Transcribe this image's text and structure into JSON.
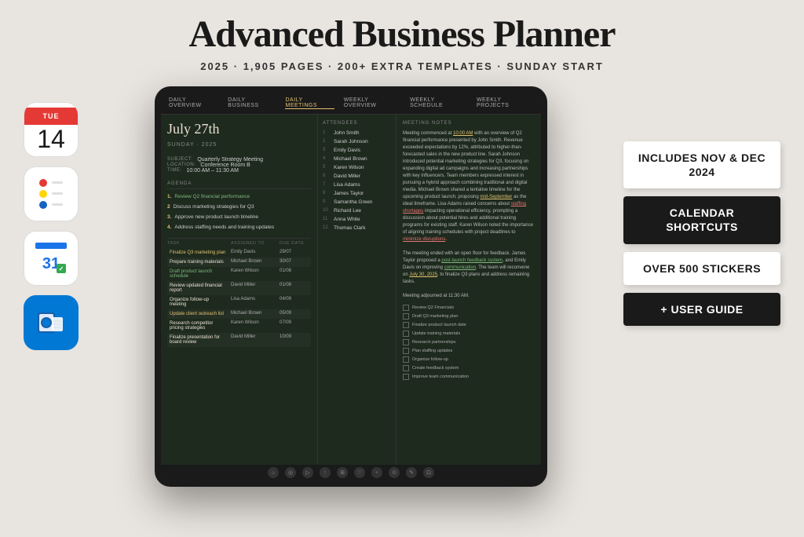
{
  "header": {
    "title": "Advanced Business Planner",
    "subtitle": "2025  ·  1,905 PAGES  ·  200+ EXTRA TEMPLATES  ·  SUNDAY START"
  },
  "left_icons": [
    {
      "id": "calendar",
      "day": "TUE",
      "date": "14"
    },
    {
      "id": "reminders"
    },
    {
      "id": "gcal",
      "number": "31"
    },
    {
      "id": "outlook"
    }
  ],
  "tablet": {
    "nav_items": [
      "DAILY OVERVIEW",
      "DAILY BUSINESS",
      "DAILY MEETINGS",
      "WEEKLY OVERVIEW",
      "WEEKLY SCHEDULE",
      "WEEKLY PROJECTS"
    ],
    "active_nav": "DAILY MEETINGS",
    "date": "July 27th",
    "date_sub": "SUNDAY · 2025",
    "subject": "Quarterly Strategy Meeting",
    "location": "Conference Room B",
    "time": "10:00 AM – 11:30 AM",
    "agenda_label": "AGENDA",
    "agenda_items": [
      {
        "num": "1.",
        "text": "Review Q2 financial performance"
      },
      {
        "num": "2",
        "text": "Discuss marketing strategies for Q3"
      },
      {
        "num": "3.",
        "text": "Approve new product launch timeline"
      },
      {
        "num": "4.",
        "text": "Address staffing needs and training updates"
      }
    ],
    "attendees_label": "ATTENDEES",
    "attendees": [
      {
        "num": "1",
        "name": "John Smith"
      },
      {
        "num": "2",
        "name": "Sarah Johnson"
      },
      {
        "num": "3",
        "name": "Emily Davis"
      },
      {
        "num": "4",
        "name": "Michael Brown"
      },
      {
        "num": "5",
        "name": "Karen Wilson"
      },
      {
        "num": "6",
        "name": "David Miller"
      },
      {
        "num": "7",
        "name": "Lisa Adams"
      },
      {
        "num": "8",
        "name": "James Taylor"
      },
      {
        "num": "9",
        "name": "Samantha Green"
      },
      {
        "num": "10",
        "name": "Richard Lee"
      },
      {
        "num": "11",
        "name": "Anna White"
      },
      {
        "num": "12",
        "name": "Thomas Clark"
      }
    ],
    "notes_label": "MEETING NOTES",
    "notes_text": "Meeting commenced at 10:00 AM with an overview of Q2 financial performance presented by John Smith. Revenue exceeded expectations by 12%, attributed to higher-than-forecasted sales in the new product line. Sarah Johnson introduced potential marketing strategies for Q3, focusing on expanding digital ad campaigns and increasing partnerships with key influencers. Team members expressed interest in pursuing a hybrid approach combining traditional and digital media. Michael Brown shared a tentative timeline for the upcoming product launch, proposing mid-September as the ideal timeframe. Lisa Adams raised concerns about staffing shortages impacting operational efficiency, prompting a discussion about potential hires and additional training programs for existing staff. Karen Wilson noted the importance of aligning training schedules with project deadlines to minimize disruptions.\n\nThe meeting ended with an open floor for feedback. James Taylor proposed a post-launch feedback system, and Emily Davis on improving communication. The team will reconvene on July 30, 2025, to finalize Q3 plans and address remaining tasks.\n\nMeeting adjourned at 11:30 AM.",
    "tasks_label": "TASK",
    "tasks_col2": "ASSIGNED TO",
    "tasks_col3": "DUE DATE",
    "tasks": [
      {
        "name": "Finalize Q3 marketing plan",
        "assigned": "Emily Davis",
        "due": "29/07",
        "color": "yellow"
      },
      {
        "name": "Prepare training materials",
        "assigned": "Michael Brown",
        "due": "30/07",
        "color": "normal"
      },
      {
        "name": "Draft product launch schedule",
        "assigned": "Karen Wilson",
        "due": "01/08",
        "color": "green"
      },
      {
        "name": "Review updated financial report",
        "assigned": "David Miller",
        "due": "01/08",
        "color": "normal"
      },
      {
        "name": "Organize follow-up meeting",
        "assigned": "Lisa Adams",
        "due": "04/09",
        "color": "normal"
      },
      {
        "name": "Update client outreach list",
        "assigned": "Michael Brown",
        "due": "05/09",
        "color": "yellow"
      },
      {
        "name": "Research competitor pricing strategies",
        "assigned": "Karen Wilson",
        "due": "07/09",
        "color": "normal"
      },
      {
        "name": "Finalize presentation for board review",
        "assigned": "David Miller",
        "due": "10/09",
        "color": "normal"
      }
    ],
    "checklist": [
      "Review Q2 Financials",
      "Draft Q3 marketing plan",
      "Finalize product launch date",
      "Update training materials",
      "Research partnerships",
      "Plan staffing updates",
      "Organize follow-up",
      "Create feedback system",
      "Improve team communication"
    ]
  },
  "badges": [
    {
      "text": "INCLUDES NOV & DEC 2024",
      "style": "light"
    },
    {
      "text": "CALENDAR SHORTCUTS",
      "style": "dark"
    },
    {
      "text": "OVER 500 STICKERS",
      "style": "light"
    },
    {
      "text": "+ USER GUIDE",
      "style": "dark"
    }
  ]
}
